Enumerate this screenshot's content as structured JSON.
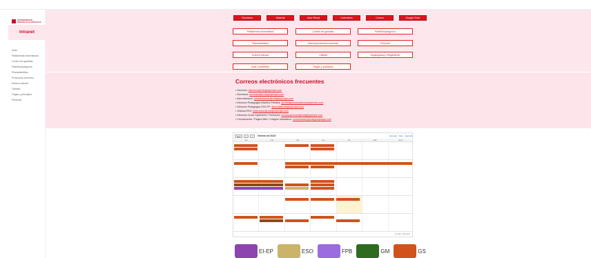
{
  "sidebar": {
    "brand_lines": [
      "ARZOBISPADO",
      "ESCUELAS CATÓLICAS"
    ],
    "title": "Intranet",
    "items": [
      "Inicio",
      "Plataformas informáticas",
      "Control de guardias",
      "Pabellón/polígonos",
      "Plazas/ámbitos",
      "Protocolos comunes",
      "Entorno laboral",
      "Calidad",
      "Origen y principios",
      "Personal"
    ]
  },
  "nav": {
    "top_buttons": [
      "Circulares",
      "Material",
      "Aula Virtual",
      "Calendario",
      "Cursos",
      "Google Drive"
    ],
    "links": [
      "Plataformas informáticas",
      "Control de guardias",
      "Pabellón/polígonos",
      "Plazas/ámbitos",
      "Manual protocolos comunes",
      "Personal",
      "Entorno laboral",
      "Calidad",
      "Organigrama y Reglamento",
      "Aula Convertible",
      "Origen y principios"
    ]
  },
  "emails": {
    "title": "Correos electrónicos frecuentes",
    "items": [
      {
        "label": "Dirección:",
        "addr": "direccion@colegioejemplo.com"
      },
      {
        "label": "Secretaría:",
        "addr": "secretaria@colegioejemplo.com"
      },
      {
        "label": "Administración:",
        "addr": "administracion@colegioejemplo.com"
      },
      {
        "label": "Dirección Pedagógica Infantil y Primaria:",
        "addr": "dpinfantilprimaria@colegioejemplo.com"
      },
      {
        "label": "Dirección Pedagógica ESO-FP:",
        "addr": "dpesofp@colegioejemplo.com"
      },
      {
        "label": "Jefatura ESO:",
        "addr": "jefaturaeso@colegioejemplo.com"
      },
      {
        "label": "Dirección Ciclos Superiores / Formación:",
        "addr": "ciclossuperiores@colegioejemplo.com"
      },
      {
        "label": "Comunicación / Página Web / Colegios Salesianos:",
        "addr": "comunicacion@colegioejemplo.com"
      }
    ]
  },
  "calendar": {
    "today_btn": "Hoy",
    "month_label": "febrero de 2023",
    "views": [
      "Semana",
      "Mes",
      "Agenda"
    ],
    "days": [
      "lun",
      "mar",
      "mié",
      "jue",
      "vie",
      "sáb",
      "dom"
    ],
    "footer": "Google Calendar"
  },
  "legend": [
    {
      "label": "EI-EP",
      "color": "#8e44ad"
    },
    {
      "label": "ESO",
      "color": "#c9b46a"
    },
    {
      "label": "FPB",
      "color": "#9b6be0"
    },
    {
      "label": "GM",
      "color": "#2e6b1f"
    },
    {
      "label": "GS",
      "color": "#d0531b"
    }
  ]
}
